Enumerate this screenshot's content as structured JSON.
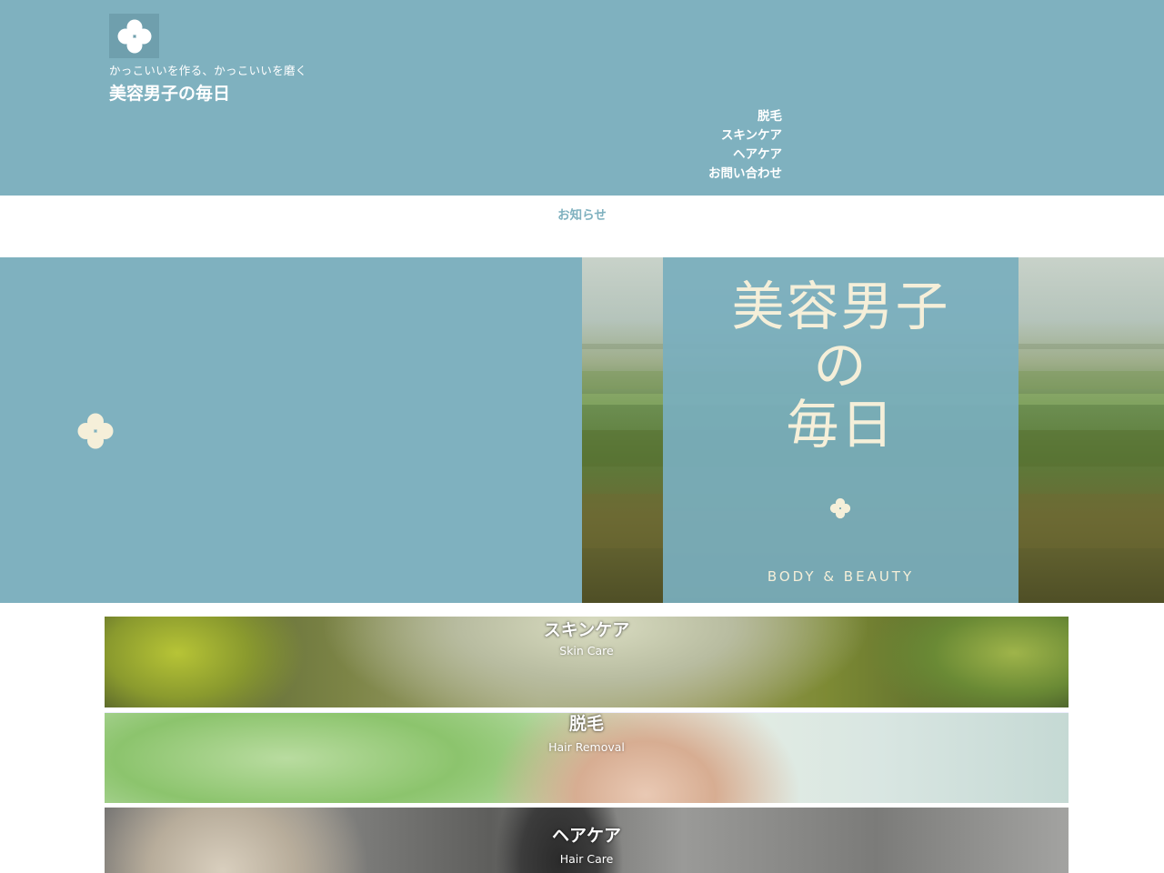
{
  "header": {
    "logo_icon": "clover-icon",
    "tagline": "かっこいいを作る、かっこいいを磨く",
    "site_title": "美容男子の毎日",
    "nav": [
      {
        "label": "脱毛"
      },
      {
        "label": "スキンケア"
      },
      {
        "label": "ヘアケア"
      },
      {
        "label": "お問い合わせ"
      }
    ]
  },
  "notice": {
    "label": "お知らせ"
  },
  "hero": {
    "mark_icon": "clover-icon",
    "card": {
      "title_line1": "美容男子",
      "title_line2": "の",
      "title_line3": "毎日",
      "mark_icon": "clover-icon",
      "subtitle": "BODY & BEAUTY"
    }
  },
  "categories": [
    {
      "title": "スキンケア",
      "subtitle": "Skin Care"
    },
    {
      "title": "脱毛",
      "subtitle": "Hair Removal"
    },
    {
      "title": "ヘアケア",
      "subtitle": "Hair Care"
    }
  ],
  "colors": {
    "brand": "#7fb1bf",
    "cream": "#f5efd9",
    "white": "#ffffff"
  }
}
